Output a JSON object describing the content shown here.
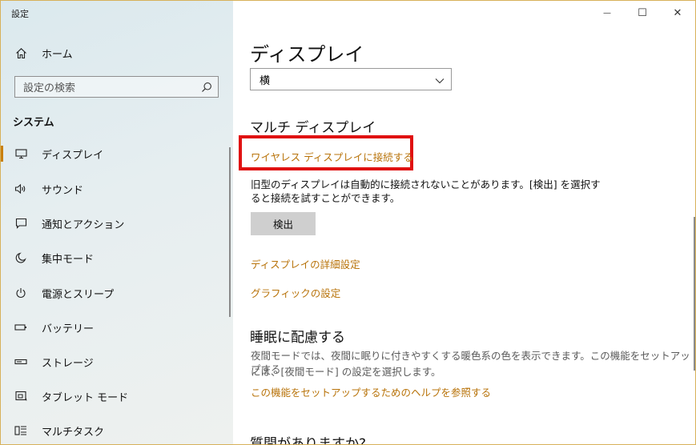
{
  "window": {
    "app_title": "設定",
    "controls": {
      "minimize": "—",
      "maximize": "☐",
      "close": "✕"
    }
  },
  "sidebar": {
    "home": "ホーム",
    "search_placeholder": "設定の検索",
    "section": "システム",
    "items": [
      {
        "label": "ディスプレイ",
        "icon": "display-icon",
        "active": true
      },
      {
        "label": "サウンド",
        "icon": "speaker-icon"
      },
      {
        "label": "通知とアクション",
        "icon": "notification-icon"
      },
      {
        "label": "集中モード",
        "icon": "moon-icon"
      },
      {
        "label": "電源とスリープ",
        "icon": "power-icon"
      },
      {
        "label": "バッテリー",
        "icon": "battery-icon"
      },
      {
        "label": "ストレージ",
        "icon": "storage-icon"
      },
      {
        "label": "タブレット モード",
        "icon": "tablet-mode-icon"
      },
      {
        "label": "マルチタスク",
        "icon": "multitask-icon"
      }
    ]
  },
  "main": {
    "title": "ディスプレイ",
    "orientation_value": "横",
    "multi_display": {
      "title": "マルチ ディスプレイ",
      "wireless_link": "ワイヤレス ディスプレイに接続する",
      "desc_line1": "旧型のディスプレイは自動的に接続されないことがあります。[検出] を選択す",
      "desc_line2": "ると接続を試すことができます。",
      "detect_button": "検出",
      "advanced_link": "ディスプレイの詳細設定",
      "graphics_link": "グラフィックの設定"
    },
    "sleep": {
      "title": "睡眠に配慮する",
      "desc_line1": "夜間モードでは、夜間に眠りに付きやすくする暖色系の色を表示できます。この機能をセットアップする",
      "desc_line2": "には、[夜間モード] の設定を選択します。",
      "help_link": "この機能をセットアップするためのヘルプを参照する"
    },
    "questions_title": "質問がありますか?"
  },
  "colors": {
    "accent": "#c97f0e",
    "link": "#b8730a",
    "highlight": "#e01010"
  }
}
